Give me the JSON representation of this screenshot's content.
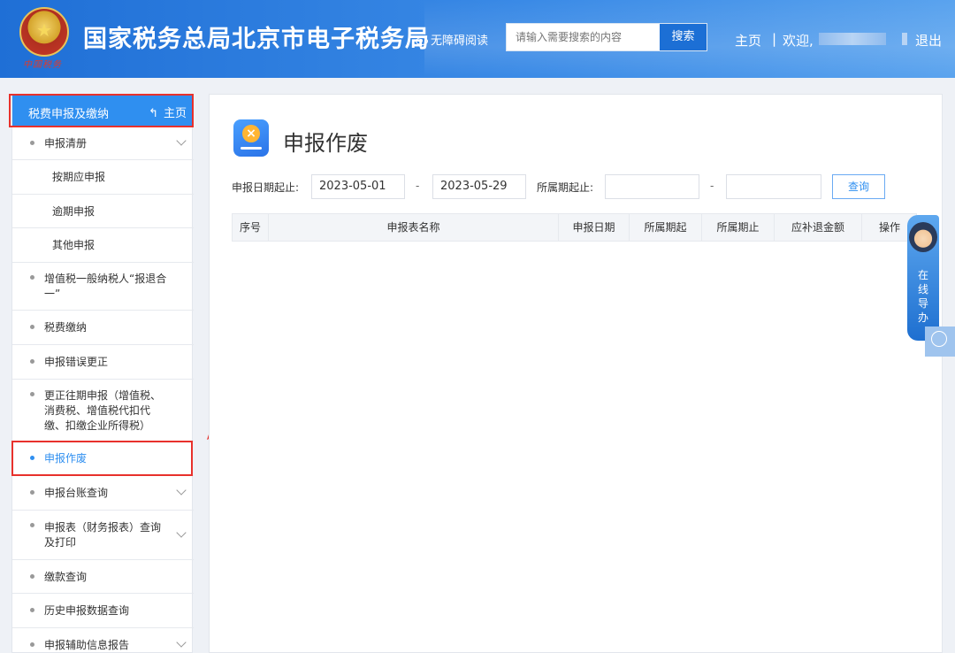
{
  "header": {
    "emblem_caption": "中国税务",
    "site_title": "国家税务总局北京市电子税务局",
    "accessibility": "无障碍阅读",
    "search_placeholder": "请输入需要搜索的内容",
    "search_button": "搜索",
    "nav_home": "主页",
    "nav_sep": "|",
    "nav_welcome": "欢迎,",
    "nav_logout": "退出"
  },
  "sidebar": {
    "title": "税费申报及缴纳",
    "home": "主页",
    "items": [
      {
        "label": "申报清册",
        "level": 1,
        "expandable": true
      },
      {
        "label": "按期应申报",
        "level": 2
      },
      {
        "label": "逾期申报",
        "level": 2
      },
      {
        "label": "其他申报",
        "level": 2
      },
      {
        "label": "增值税一般纳税人“报退合一”",
        "level": 1
      },
      {
        "label": "税费缴纳",
        "level": 1
      },
      {
        "label": "申报错误更正",
        "level": 1
      },
      {
        "label": "更正往期申报（增值税、消费税、增值税代扣代缴、扣缴企业所得税）",
        "level": 1
      },
      {
        "label": "申报作废",
        "level": 1,
        "active": true
      },
      {
        "label": "申报台账查询",
        "level": 1,
        "expandable": true
      },
      {
        "label": "申报表（财务报表）查询及打印",
        "level": 1,
        "expandable": true
      },
      {
        "label": "缴款查询",
        "level": 1
      },
      {
        "label": "历史申报数据查询",
        "level": 1
      },
      {
        "label": "申报辅助信息报告",
        "level": 1,
        "expandable": true
      }
    ]
  },
  "main": {
    "page_title": "申报作废",
    "filters": {
      "declare_date_label": "申报日期起止:",
      "declare_date_start": "2023-05-01",
      "declare_date_end": "2023-05-29",
      "dash": "-",
      "period_label": "所属期起止:",
      "period_start": "",
      "period_end": "",
      "query_button": "查询"
    },
    "table_headers": [
      "序号",
      "申报表名称",
      "申报日期",
      "所属期起",
      "所属期止",
      "应补退金额",
      "操作"
    ]
  },
  "helper": {
    "text": "在线导办"
  },
  "colors": {
    "header_blue": "#1f6fd6",
    "sidebar_head": "#2f8ff0",
    "highlight_red": "#e8312c",
    "active_text": "#2f8ff0"
  }
}
